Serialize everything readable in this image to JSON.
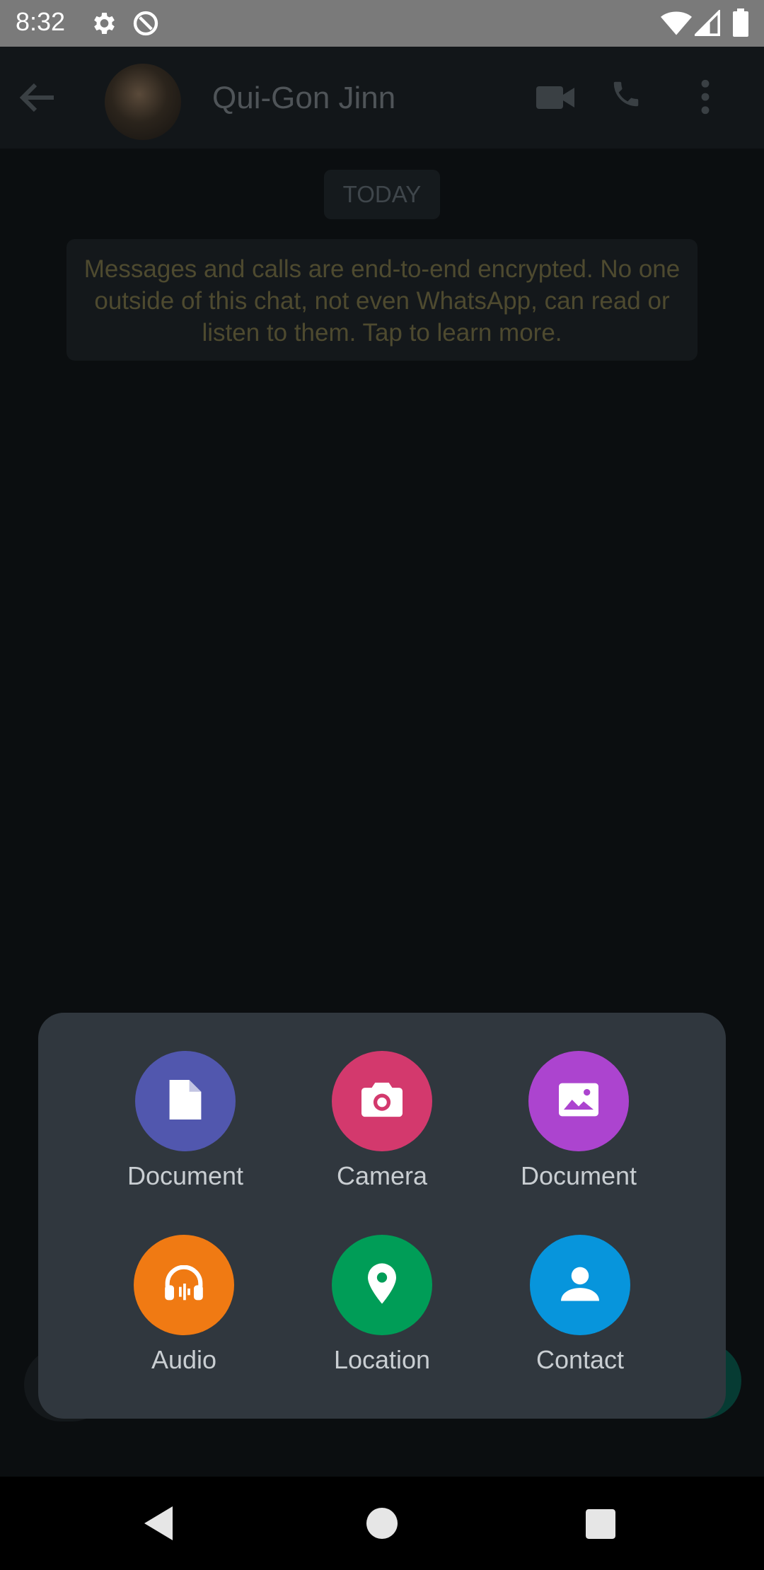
{
  "status_bar": {
    "time": "8:32",
    "icons": [
      "settings-icon",
      "no-data-saver-icon",
      "wifi-icon",
      "signal-icon",
      "battery-icon"
    ]
  },
  "chat_header": {
    "contact_name": "Qui-Gon Jinn",
    "icons": [
      "back-arrow-icon",
      "video-call-icon",
      "voice-call-icon",
      "more-options-icon"
    ]
  },
  "chat": {
    "date_label": "TODAY",
    "encryption_notice": "Messages and calls are end-to-end encrypted. No one outside of this chat, not even WhatsApp, can read or listen to them. Tap to learn more."
  },
  "attach_menu": {
    "items": [
      {
        "label": "Document",
        "icon": "document-icon",
        "color": "#5157ae"
      },
      {
        "label": "Camera",
        "icon": "camera-icon",
        "color": "#d3396d"
      },
      {
        "label": "Document",
        "icon": "gallery-icon",
        "color": "#ac44cf"
      },
      {
        "label": "Audio",
        "icon": "headphones-icon",
        "color": "#f07a13"
      },
      {
        "label": "Location",
        "icon": "location-pin-icon",
        "color": "#009d57"
      },
      {
        "label": "Contact",
        "icon": "person-icon",
        "color": "#0795dc"
      }
    ]
  },
  "nav_bar": {
    "icons": [
      "back-triangle-icon",
      "home-circle-icon",
      "recents-square-icon"
    ]
  }
}
